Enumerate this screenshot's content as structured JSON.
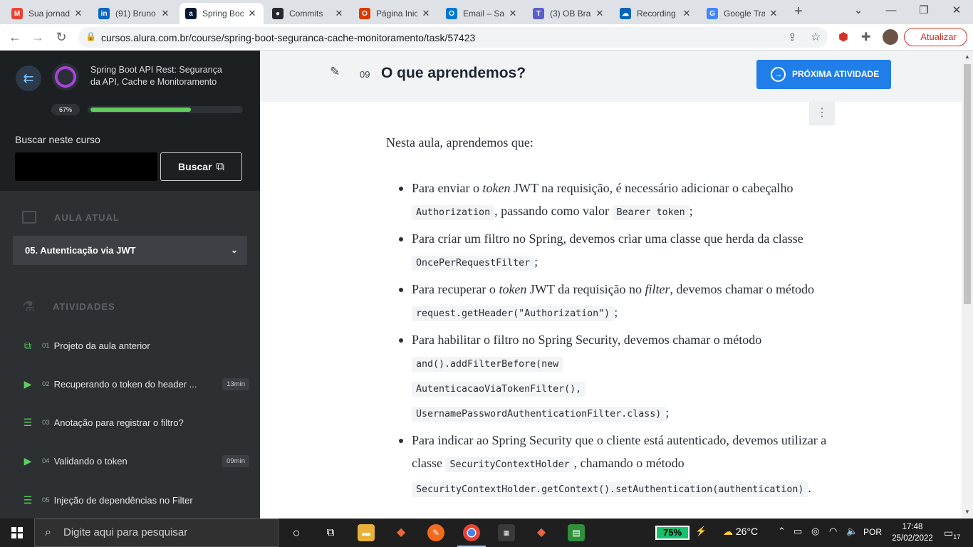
{
  "browser": {
    "tabs": [
      {
        "title": "Sua jornada",
        "icon": "gmail-icon",
        "color": "#ea4335",
        "glyph": "M"
      },
      {
        "title": "(91) Bruno",
        "icon": "linkedin-icon",
        "color": "#0a66c2",
        "glyph": "in"
      },
      {
        "title": "Spring Boot",
        "icon": "alura-icon",
        "color": "#051933",
        "glyph": "a"
      },
      {
        "title": "Commits",
        "icon": "github-icon",
        "color": "#24292f",
        "glyph": "●"
      },
      {
        "title": "Página Inic",
        "icon": "office-icon",
        "color": "#d83b01",
        "glyph": "O"
      },
      {
        "title": "Email – Sa",
        "icon": "outlook-icon",
        "color": "#0078d4",
        "glyph": "O"
      },
      {
        "title": "(3) OB Bra",
        "icon": "teams-icon",
        "color": "#5b5fc7",
        "glyph": "T"
      },
      {
        "title": "Recording",
        "icon": "onedrive-icon",
        "color": "#0364b8",
        "glyph": "☁"
      },
      {
        "title": "Google Tra",
        "icon": "google-translate-icon",
        "color": "#4285f4",
        "glyph": "G"
      }
    ],
    "url": "cursos.alura.com.br/course/spring-boot-seguranca-cache-monitoramento/task/57423",
    "update_label": "Atualizar"
  },
  "sidebar": {
    "course_title": "Spring Boot API Rest: Segurança da API, Cache e Monitoramento",
    "progress_label": "67%",
    "progress": 0.67,
    "search_label": "Buscar neste curso",
    "search_placeholder": "",
    "search_button": "Buscar",
    "current_lesson_header": "AULA ATUAL",
    "current_lesson": "05. Autenticação via JWT",
    "activities_header": "ATIVIDADES",
    "activities": [
      {
        "num": "01",
        "label": "Projeto da aula anterior",
        "type": "book",
        "duration": ""
      },
      {
        "num": "02",
        "label": "Recuperando o token do header ...",
        "type": "video",
        "duration": "13min"
      },
      {
        "num": "03",
        "label": "Anotação para registrar o filtro?",
        "type": "list",
        "duration": ""
      },
      {
        "num": "04",
        "label": "Validando o token",
        "type": "video",
        "duration": "09min"
      },
      {
        "num": "05",
        "label": "Injeção de dependências no Filter",
        "type": "list",
        "duration": ""
      }
    ]
  },
  "main": {
    "activity_number": "09",
    "activity_title": "O que aprendemos?",
    "next_button": "PRÓXIMA ATIVIDADE",
    "intro": "Nesta aula, aprendemos que:",
    "points": {
      "p1": {
        "a": "Para enviar o ",
        "em1": "token",
        "b": " JWT na requisição, é necessário adicionar o cabeçalho ",
        "c1": "Authorization",
        "c": ", passando como valor ",
        "c2": "Bearer token",
        "d": ";"
      },
      "p2": {
        "a": "Para criar um filtro no Spring, devemos criar uma classe que herda da classe ",
        "c1": "OncePerRequestFilter",
        "b": ";"
      },
      "p3": {
        "a": "Para recuperar o ",
        "em1": "token",
        "b": " JWT da requisição no ",
        "em2": "filter",
        "c": ", devemos chamar o método ",
        "c1": "request.getHeader(\"Authorization\")",
        "d": ";"
      },
      "p4": {
        "a": "Para habilitar o filtro no Spring Security, devemos chamar o método ",
        "c1": "and().addFilterBefore(new",
        "c2": "AutenticacaoViaTokenFilter(),",
        "c3": "UsernamePasswordAuthenticationFilter.class)",
        "b": ";"
      },
      "p5": {
        "a": "Para indicar ao Spring Security que o cliente está autenticado, devemos utilizar a classe ",
        "c1": "SecurityContextHolder",
        "b": ", chamando o método ",
        "c2": "SecurityContextHolder.getContext().setAuthentication(authentication)",
        "c": "."
      }
    }
  },
  "taskbar": {
    "search_placeholder": "Digite aqui para pesquisar",
    "battery": "75%",
    "temperature": "26°C",
    "language": "POR",
    "time": "17:48",
    "date": "25/02/2022",
    "notifications": "17"
  }
}
